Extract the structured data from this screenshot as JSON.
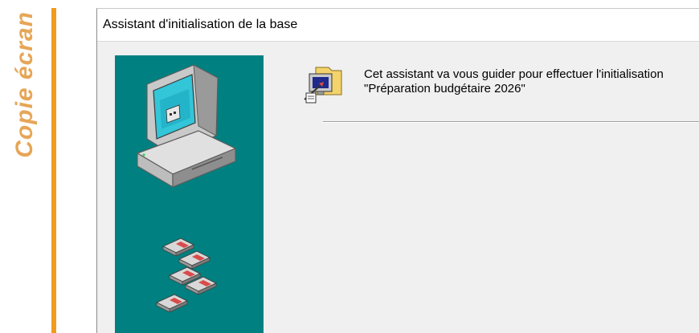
{
  "side_caption": "Copie écran",
  "colors": {
    "caption": "#e6a657",
    "accent_bar": "#f29a1f",
    "panel": "#008080",
    "dialog_bg": "#f0f0f0"
  },
  "window": {
    "title": "Assistant d'initialisation de la base"
  },
  "content": {
    "intro_line1": "Cet assistant va vous guider pour effectuer l'initialisation",
    "intro_line2": "\"Préparation budgétaire 2026\""
  },
  "icons": {
    "panel": [
      "computer-icon",
      "floppy-disk-icon"
    ],
    "header": "wizard-icon"
  }
}
